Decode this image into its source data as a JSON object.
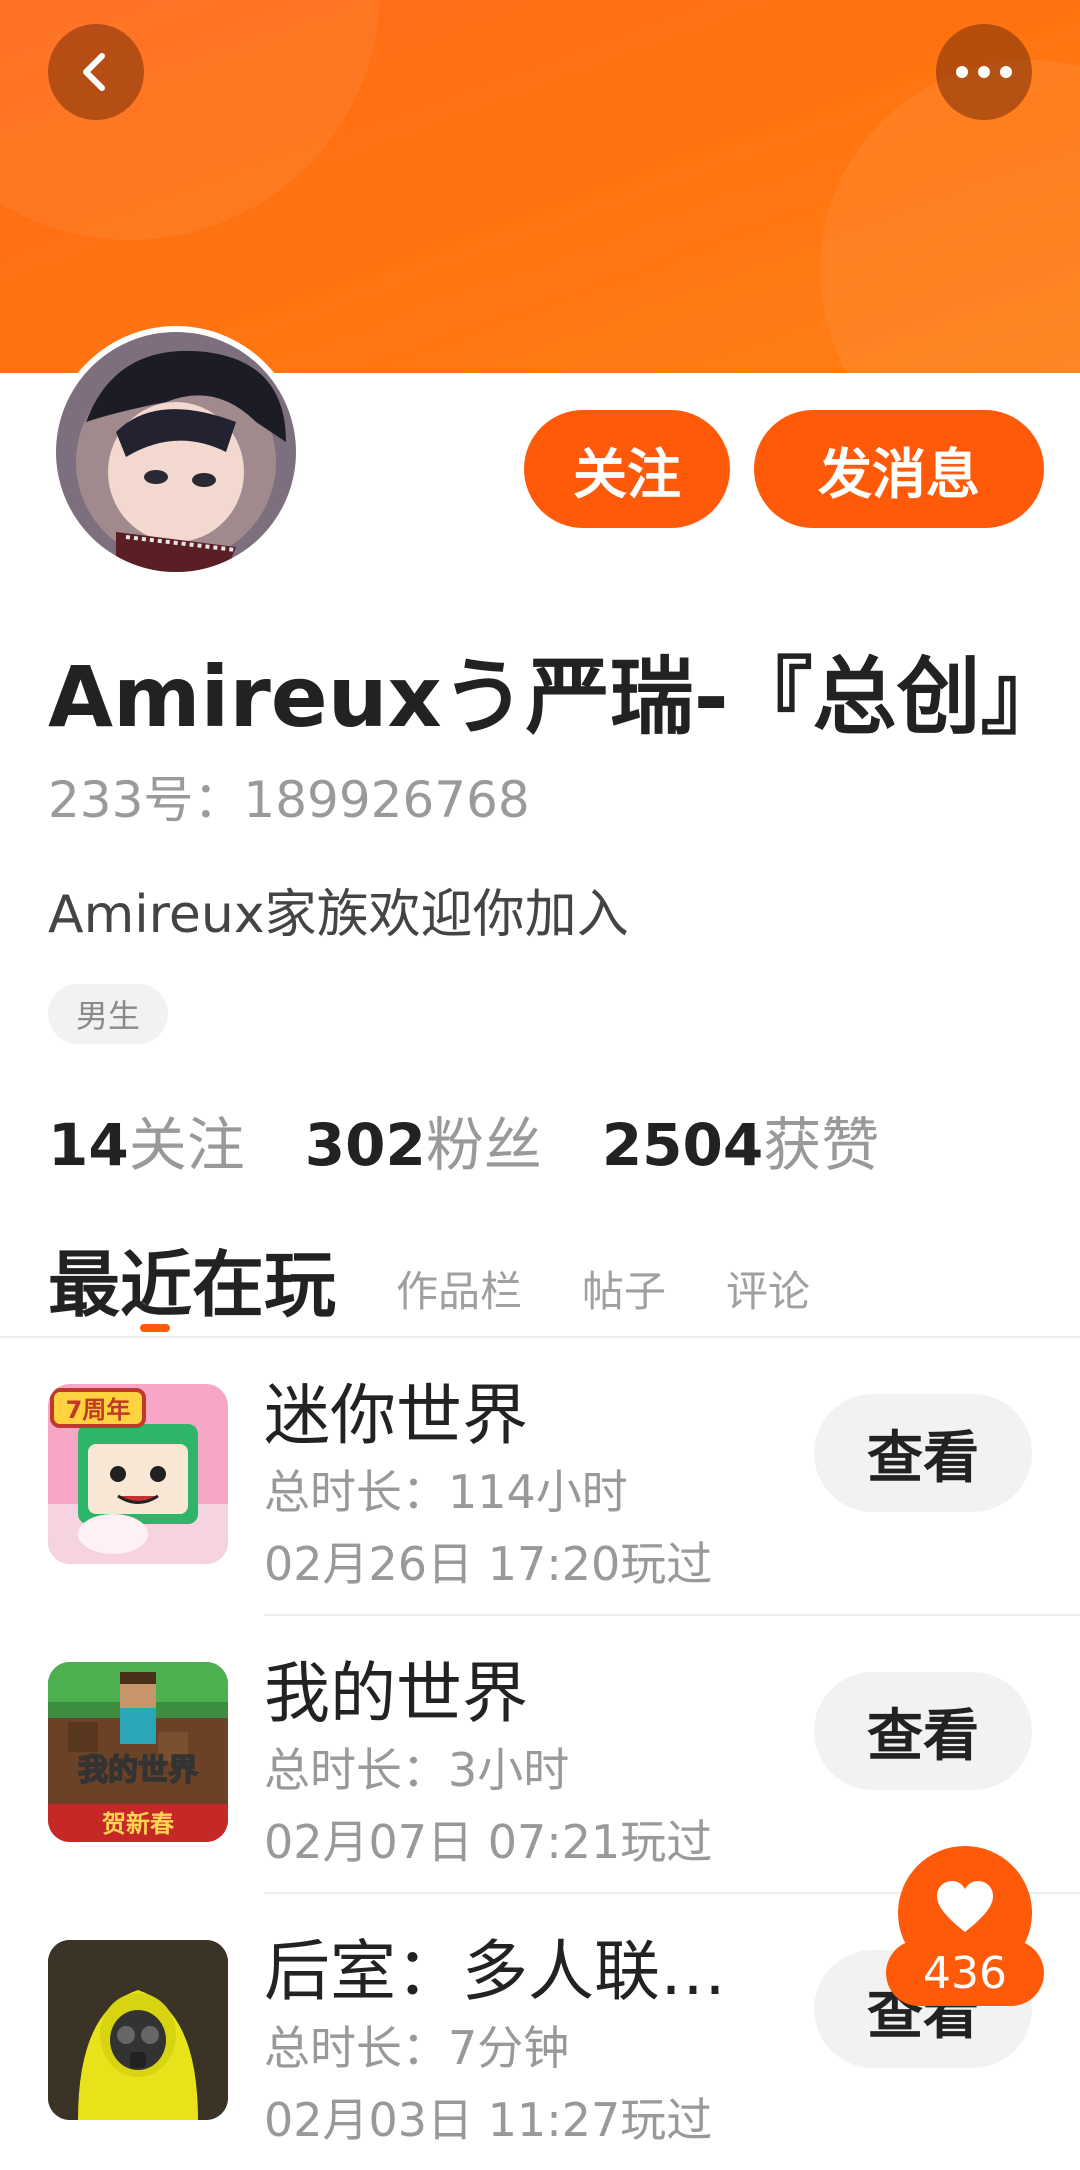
{
  "profile": {
    "name": "Amireuxう严瑞-『总创』",
    "uid_text": "233号：189926768",
    "bio": "Amireux家族欢迎你加入",
    "gender_tag": "男生"
  },
  "actions": {
    "follow_label": "关注",
    "message_label": "发消息"
  },
  "stats": [
    {
      "num": "14",
      "label": "关注"
    },
    {
      "num": "302",
      "label": "粉丝"
    },
    {
      "num": "2504",
      "label": "获赞"
    }
  ],
  "tabs": {
    "active": "最近在玩",
    "others": [
      "作品栏",
      "帖子",
      "评论"
    ]
  },
  "games": [
    {
      "title": "迷你世界",
      "duration": "总时长：114小时",
      "last_played": "02月26日 17:20玩过",
      "view_label": "查看",
      "icon": "mini-world-game-icon",
      "badge": "7周年"
    },
    {
      "title": "我的世界",
      "duration": "总时长：3小时",
      "last_played": "02月07日 07:21玩过",
      "view_label": "查看",
      "icon": "minecraft-game-icon",
      "badge": "我的世界",
      "subbadge": "贺新春"
    },
    {
      "title": "后室：多人联…",
      "duration": "总时长：7分钟",
      "last_played": "02月03日 11:27玩过",
      "view_label": "查看",
      "icon": "backrooms-game-icon"
    }
  ],
  "like": {
    "count": "436",
    "icon": "heart-icon"
  },
  "colors": {
    "accent": "#ff5a0a",
    "header": "#ff7410"
  }
}
